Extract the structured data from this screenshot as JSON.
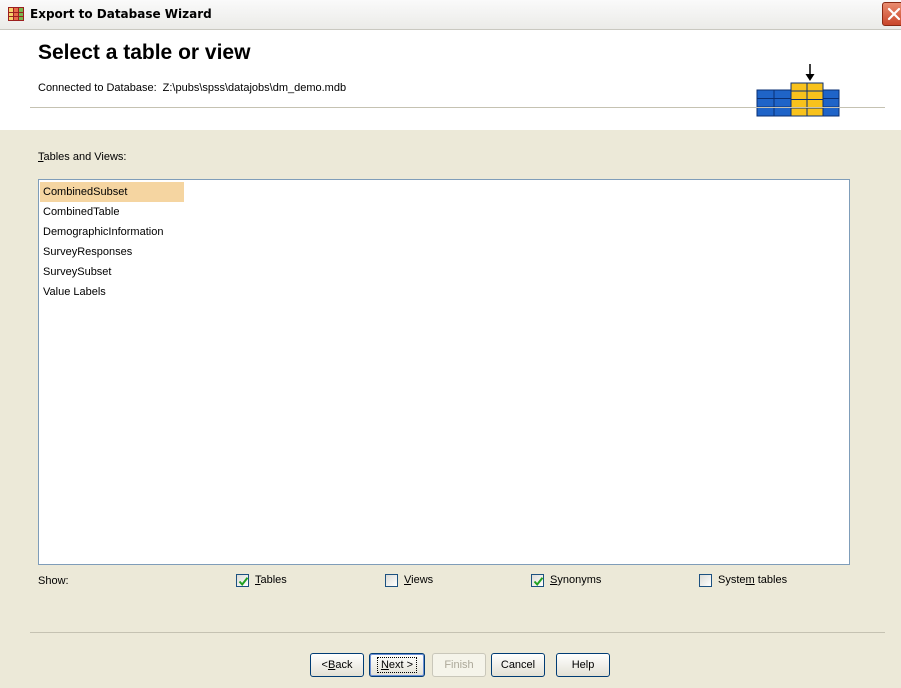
{
  "window": {
    "title": "Export to Database Wizard",
    "icon": "spreadsheet-icon",
    "close_icon": "close-icon"
  },
  "header": {
    "title": "Select a table or view",
    "connected_label": "Connected to Database:",
    "connected_path": "Z:\\pubs\\spss\\datajobs\\dm_demo.mdb",
    "icon": "database-table-icon"
  },
  "tables_list": {
    "label_mnemonic": "T",
    "label_rest": "ables and Views:",
    "items": [
      {
        "label": "CombinedSubset",
        "selected": true
      },
      {
        "label": "CombinedTable",
        "selected": false
      },
      {
        "label": "DemographicInformation",
        "selected": false
      },
      {
        "label": "SurveyResponses",
        "selected": false
      },
      {
        "label": "SurveySubset",
        "selected": false
      },
      {
        "label": "Value Labels",
        "selected": false
      }
    ]
  },
  "show": {
    "label": "Show:",
    "tables": {
      "pre": "",
      "mnemonic": "T",
      "post": "ables",
      "checked": true
    },
    "views": {
      "pre": "",
      "mnemonic": "V",
      "post": "iews",
      "checked": false
    },
    "synonyms": {
      "pre": "",
      "mnemonic": "S",
      "post": "ynonyms",
      "checked": true
    },
    "system_tables": {
      "pre": "Syste",
      "mnemonic": "m",
      "post": " tables",
      "checked": false
    }
  },
  "buttons": {
    "back": {
      "pre": "< ",
      "mnemonic": "B",
      "post": "ack"
    },
    "next": {
      "pre": "",
      "mnemonic": "N",
      "post": "ext >"
    },
    "finish": "Finish",
    "cancel": "Cancel",
    "help": "Help"
  },
  "colors": {
    "selection": "#f5d5a1",
    "dialog_bg": "#ece9d8",
    "list_border": "#7f9db9",
    "icon_blue": "#1f64c8",
    "icon_yellow": "#f8c21c"
  }
}
